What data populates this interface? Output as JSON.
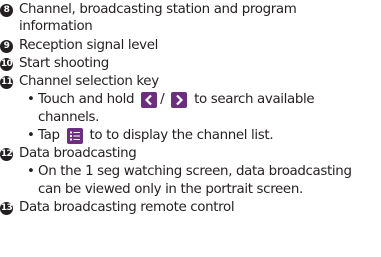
{
  "items": [
    {
      "num": "8",
      "lines": [
        "Channel, broadcasting station and program",
        "information"
      ]
    },
    {
      "num": "9",
      "lines": [
        "Reception signal level"
      ]
    },
    {
      "num": "10",
      "lines": [
        "Start shooting"
      ]
    },
    {
      "num": "11",
      "lines": [
        "Channel selection key"
      ]
    },
    {
      "num": "12",
      "lines": [
        "Data broadcasting"
      ]
    },
    {
      "num": "13",
      "lines": [
        "Data broadcasting remote control"
      ]
    }
  ],
  "sub_items": {
    "touch_hold_pre": "Touch and hold",
    "touch_hold_mid": "/",
    "touch_hold_post": "to search available",
    "touch_hold_cont": "channels.",
    "tap_pre": "Tap",
    "tap_post": "to to display the channel list.",
    "oneseg_line1": "On the 1 seg watching screen, data broadcasting",
    "oneseg_line2": "can be viewed only in the portrait screen."
  },
  "bullet": "•",
  "colors": {
    "text": "#231f20",
    "key": "#6c2f80"
  },
  "icons": [
    "chevron-left-icon",
    "chevron-right-icon",
    "channel-list-icon"
  ]
}
